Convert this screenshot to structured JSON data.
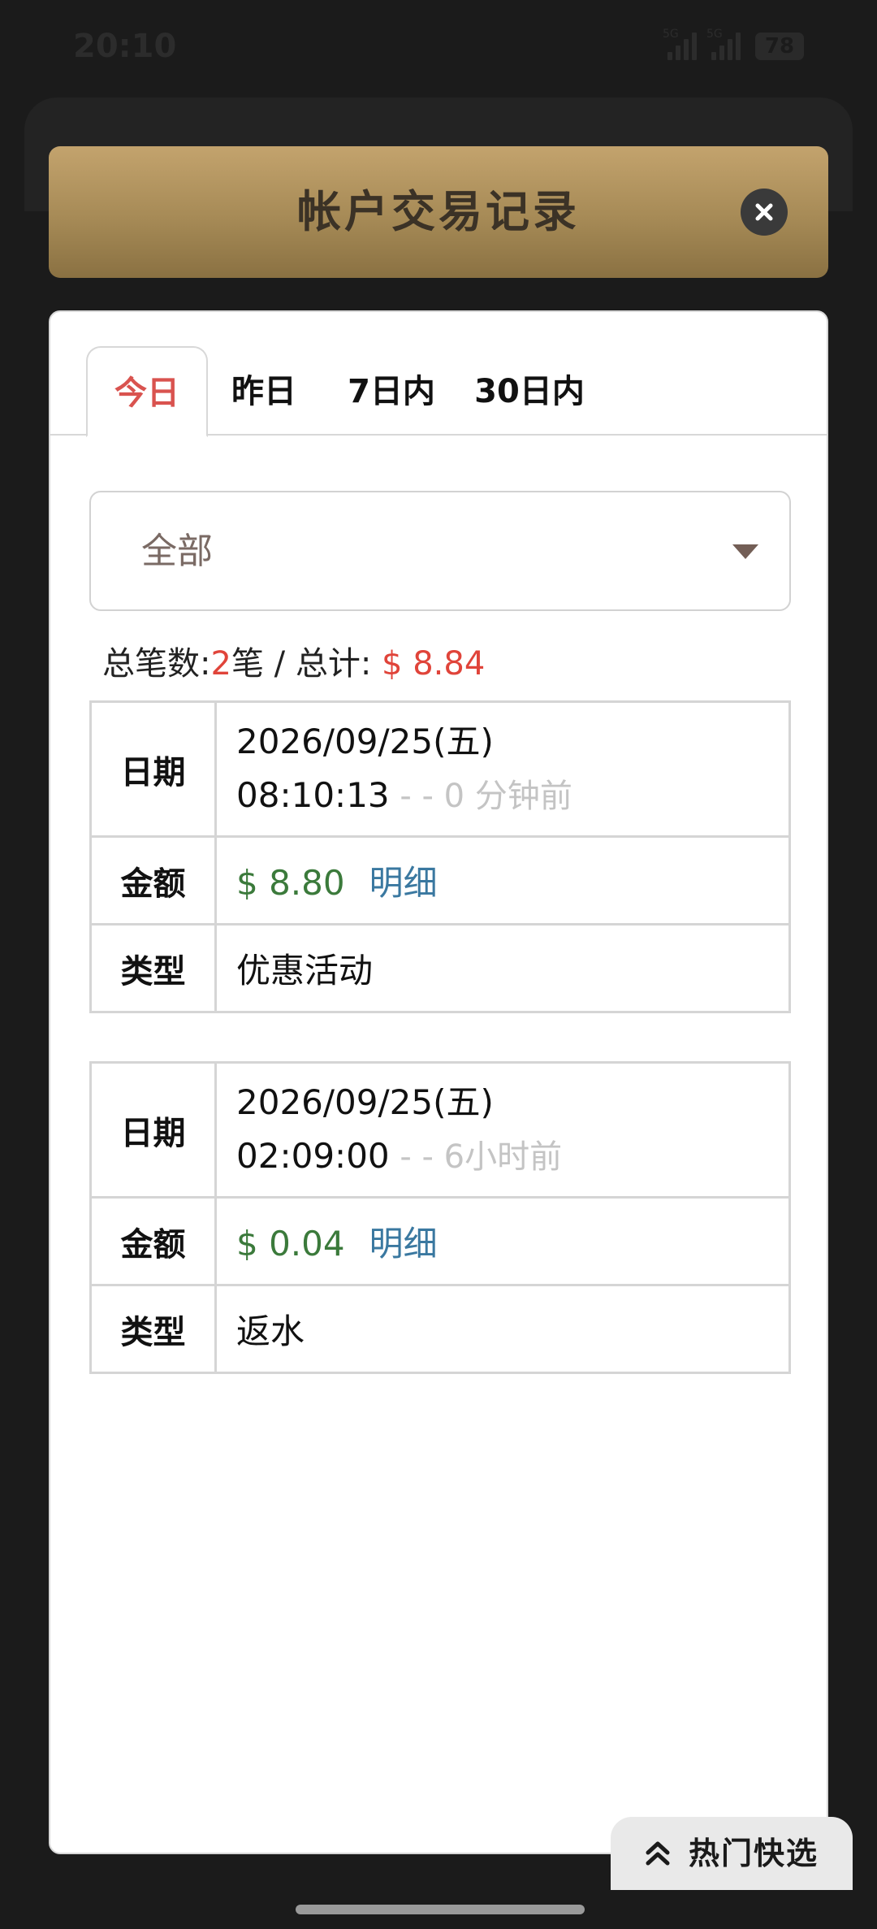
{
  "status_bar": {
    "time": "20:10",
    "signal1_label": "5G",
    "signal2_label": "5G",
    "battery": "78"
  },
  "modal": {
    "title": "帐户交易记录",
    "close_icon": "close-icon"
  },
  "tabs": [
    {
      "label": "今日",
      "active": true
    },
    {
      "label": "昨日",
      "active": false
    },
    {
      "label": "7日内",
      "active": false
    },
    {
      "label": "30日内",
      "active": false
    }
  ],
  "filter": {
    "selected": "全部"
  },
  "summary": {
    "count_label": "总笔数:",
    "count": "2",
    "count_unit": "笔",
    "separator": " / ",
    "total_label": "总计:",
    "total": "$ 8.84"
  },
  "records": [
    {
      "date_key": "日期",
      "date": "2026/09/25(五)",
      "time": "08:10:13",
      "ago": " - - 0 分钟前",
      "amount_key": "金额",
      "amount": "$ 8.80",
      "detail": "明细",
      "type_key": "类型",
      "type": "优惠活动"
    },
    {
      "date_key": "日期",
      "date": "2026/09/25(五)",
      "time": "02:09:00",
      "ago": " - - 6小时前",
      "amount_key": "金额",
      "amount": "$ 0.04",
      "detail": "明细",
      "type_key": "类型",
      "type": "返水"
    }
  ],
  "hot_button": {
    "label": "热门快选",
    "icon": "double-chevron-up-icon"
  },
  "colors": {
    "accent_red": "#e0443a",
    "amount_green": "#3b7a3b",
    "link_blue": "#3a78a0",
    "header_gold": "#b3955f"
  }
}
